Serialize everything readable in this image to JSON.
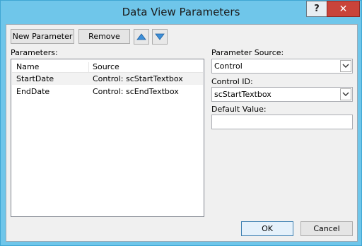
{
  "window": {
    "title": "Data View Parameters"
  },
  "titlebar": {
    "help_label": "?",
    "close_label": "✕"
  },
  "toolbar": {
    "new_parameter_label": "New Parameter",
    "remove_label": "Remove"
  },
  "parameters": {
    "label": "Parameters:",
    "columns": [
      "Name",
      "Source"
    ],
    "rows": [
      {
        "name": "StartDate",
        "source": "Control: scStartTextbox"
      },
      {
        "name": "EndDate",
        "source": "Control: scEndTextbox"
      }
    ]
  },
  "right": {
    "parameter_source_label": "Parameter Source:",
    "parameter_source_value": "Control",
    "control_id_label": "Control ID:",
    "control_id_value": "scStartTextbox",
    "default_value_label": "Default Value:",
    "default_value_value": ""
  },
  "footer": {
    "ok_label": "OK",
    "cancel_label": "Cancel"
  },
  "icons": {
    "up": "arrow-up-icon",
    "down": "arrow-down-icon",
    "dropdown": "chevron-down-icon",
    "help": "help-icon",
    "close": "close-icon"
  },
  "colors": {
    "titlebar": "#6fc6ea",
    "close_button": "#c9443a",
    "arrow_blue": "#3d8fd8"
  }
}
